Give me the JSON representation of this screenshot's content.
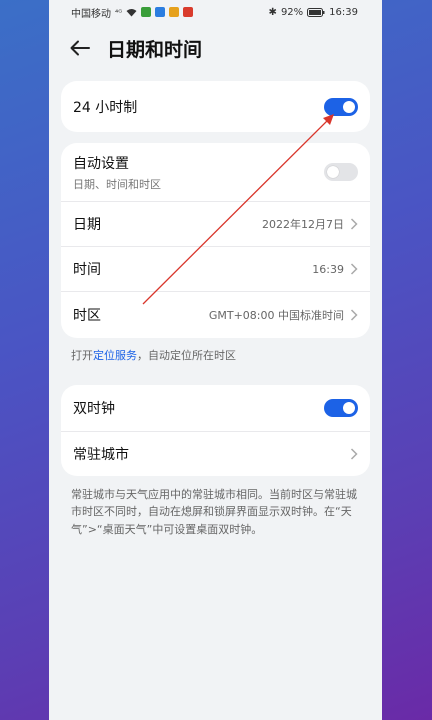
{
  "statusbar": {
    "carrier": "中国移动",
    "signal": "⁴ᴳ",
    "battery": "92%",
    "time": "16:39"
  },
  "header": {
    "title": "日期和时间"
  },
  "card1": {
    "label": "24 小时制",
    "toggle_on": true
  },
  "card2": {
    "auto": {
      "label": "自动设置",
      "sub": "日期、时间和时区",
      "toggle_on": false
    },
    "date": {
      "label": "日期",
      "value": "2022年12月7日"
    },
    "time": {
      "label": "时间",
      "value": "16:39"
    },
    "timezone": {
      "label": "时区",
      "value": "GMT+08:00 中国标准时间"
    }
  },
  "hint": {
    "prefix": "打开",
    "link": "定位服务",
    "suffix": "，自动定位所在时区"
  },
  "card3": {
    "dual": {
      "label": "双时钟",
      "toggle_on": true
    },
    "city": {
      "label": "常驻城市"
    }
  },
  "note": "常驻城市与天气应用中的常驻城市相同。当前时区与常驻城市时区不同时，自动在熄屏和锁屏界面显示双时钟。在“天气”>“桌面天气”中可设置桌面双时钟。",
  "colors": {
    "accent": "#1c62e6",
    "annotation": "#d9362c"
  }
}
